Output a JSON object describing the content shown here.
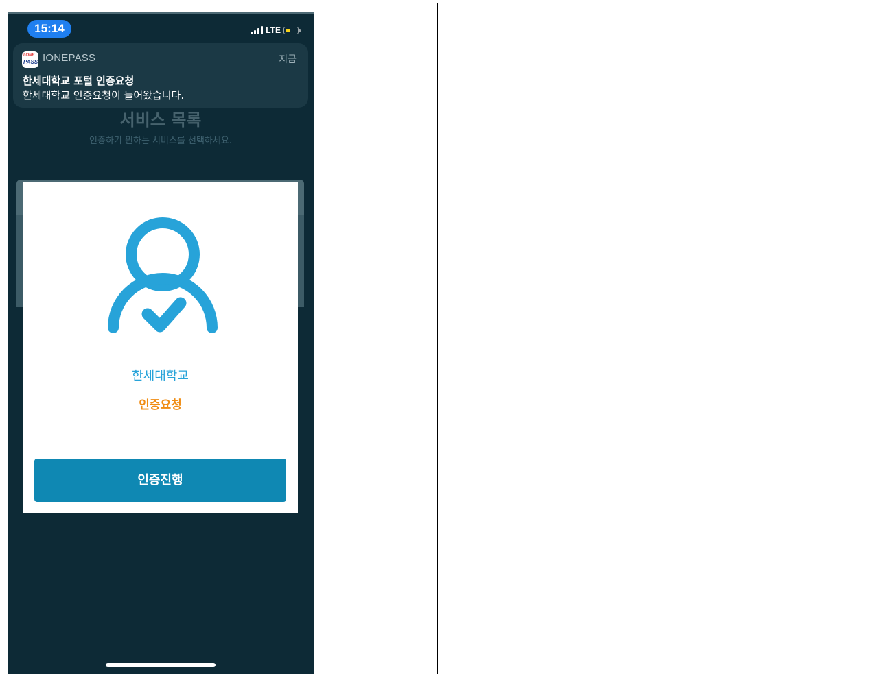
{
  "status_bar": {
    "time": "15:14",
    "network": "LTE"
  },
  "notification": {
    "app_name": "IONEPASS",
    "app_icon_line1": "I ONE",
    "app_icon_line2": "PASS",
    "time": "지금",
    "title": "한세대학교 포털 인증요청",
    "body": "한세대학교 인증요청이 들어왔습니다."
  },
  "background_app": {
    "title": "서비스 목록",
    "subtitle": "인증하기 원하는 서비스를 선택하세요."
  },
  "modal": {
    "icon": "user-check-icon",
    "organization": "한세대학교",
    "status": "인증요청",
    "button_label": "인증진행"
  },
  "colors": {
    "phone_background": "#0d2a36",
    "accent_blue": "#27a3d9",
    "status_orange": "#f08c12",
    "button_blue": "#0f88b3",
    "time_pill": "#1f7ff0"
  }
}
